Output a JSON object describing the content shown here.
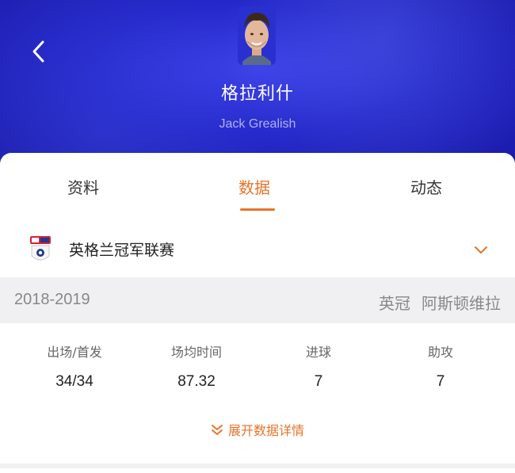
{
  "player": {
    "name_cn": "格拉利什",
    "name_en": "Jack Grealish"
  },
  "tabs": [
    {
      "label": "资料",
      "active": false
    },
    {
      "label": "数据",
      "active": true
    },
    {
      "label": "动态",
      "active": false
    }
  ],
  "league": {
    "name": "英格兰冠军联赛",
    "logo_icon": "sky-bet-championship-logo"
  },
  "season": {
    "year": "2018-2019",
    "competition": "英冠",
    "team": "阿斯顿维拉"
  },
  "stats": [
    {
      "label": "出场/首发",
      "value": "34/34"
    },
    {
      "label": "场均时间",
      "value": "87.32"
    },
    {
      "label": "进球",
      "value": "7"
    },
    {
      "label": "助攻",
      "value": "7"
    }
  ],
  "expand_label": "展开数据详情",
  "colors": {
    "accent": "#e8732a",
    "header_blue": "#2427c9"
  }
}
